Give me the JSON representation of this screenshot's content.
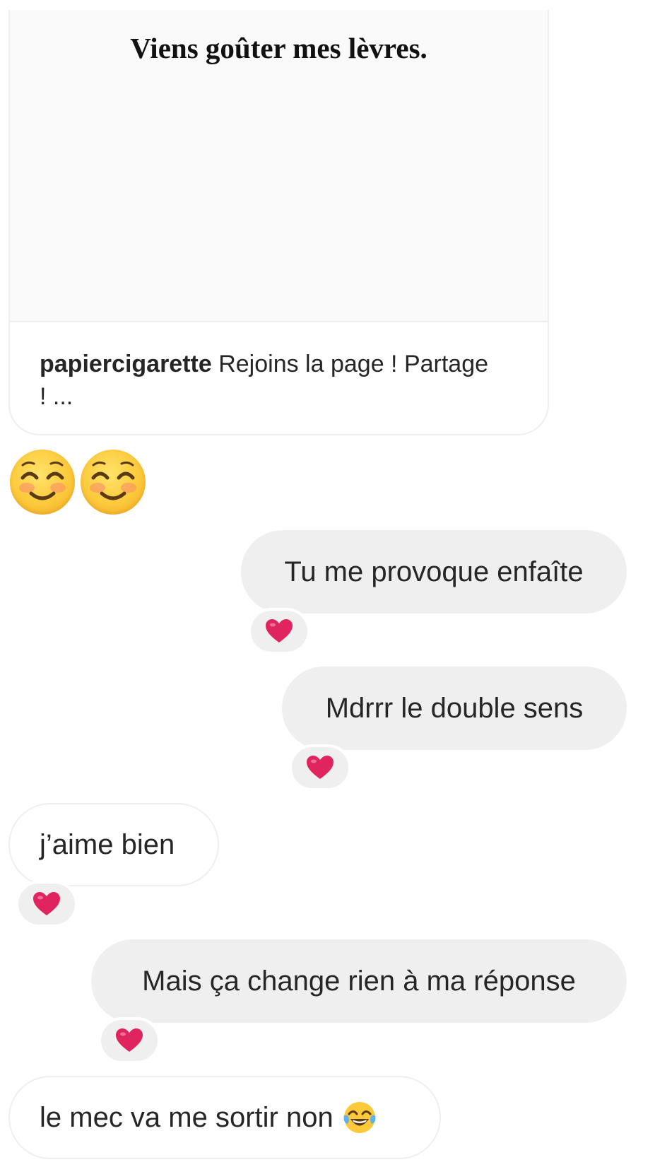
{
  "shared_post": {
    "quote": "Viens goûter mes lèvres.",
    "username": "papiercigarette",
    "caption": "Rejoins la page ! Partage ! ..."
  },
  "messages": [
    {
      "direction": "incoming",
      "text": ""
    },
    {
      "direction": "outgoing",
      "text": "Tu me provoque enfaîte",
      "reaction": "heart"
    },
    {
      "direction": "outgoing",
      "text": "Mdrrr le double sens",
      "reaction": "heart"
    },
    {
      "direction": "incoming",
      "text": "j’aime bien",
      "reaction": "heart"
    },
    {
      "direction": "outgoing",
      "text": "Mais ça change rien à ma réponse",
      "reaction": "heart"
    },
    {
      "direction": "incoming",
      "text": "le mec va me sortir non"
    }
  ],
  "icons": {
    "emoji_row": [
      "smiling-face-with-smiling-eyes-icon",
      "smiling-face-with-smiling-eyes-icon"
    ],
    "reaction": "red-heart-icon",
    "last_message_emoji": "face-with-tears-of-joy-icon"
  },
  "colors": {
    "outgoing_bubble": "#efefef",
    "incoming_border": "#efefef",
    "text": "#262626",
    "heart": "#e0245e"
  }
}
